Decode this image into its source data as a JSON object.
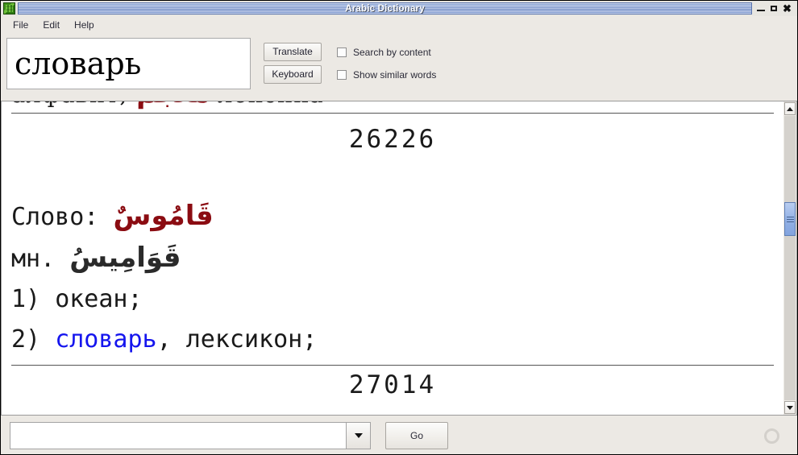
{
  "window": {
    "title": "Arabic Dictionary",
    "app_icon": "app-icon",
    "controls": {
      "minimize": "–",
      "maximize": "□",
      "close": "✖"
    }
  },
  "menubar": {
    "items": [
      {
        "label": "File"
      },
      {
        "label": "Edit"
      },
      {
        "label": "Help"
      }
    ]
  },
  "toolbar": {
    "word_value": "словарь",
    "translate_label": "Translate",
    "keyboard_label": "Keyboard",
    "checkboxes": [
      {
        "label": "Search by content",
        "checked": false
      },
      {
        "label": "Show similar words",
        "checked": false
      }
    ]
  },
  "content": {
    "clipped_top": {
      "russian_start": "алфавит;",
      "arabic": "مُعْجَمٌ",
      "russian_end": "лексика"
    },
    "entry_number": "26226",
    "word_label": "Слово:",
    "word_arabic": "قَامُوسٌ",
    "plural_label": "мн.",
    "plural_arabic": "قَوَامِيسُ",
    "senses": [
      {
        "number": "1)",
        "text": "океан;",
        "link": ""
      },
      {
        "number": "2)",
        "link": "словарь",
        "text": ", лексикон;"
      }
    ],
    "next_entry_number": "27014"
  },
  "scrollbar": {
    "up_arrow": "scroll-up-arrow",
    "down_arrow": "scroll-down-arrow"
  },
  "bottombar": {
    "search_value": "",
    "search_placeholder": "",
    "dropdown_icon": "chevron-down-icon",
    "go_label": "Go",
    "spinner": "loading-spinner"
  },
  "colors": {
    "titlebar_accent": "#7c96cd",
    "arabic_red": "#8b0c12",
    "link_blue": "#1515ee",
    "window_bg": "#ece9e4"
  }
}
